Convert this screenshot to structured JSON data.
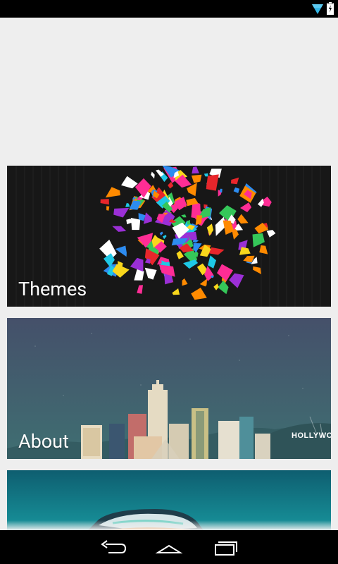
{
  "status_bar": {
    "icons": [
      "wifi-icon",
      "battery-charging-icon"
    ]
  },
  "cards": [
    {
      "label": "Themes"
    },
    {
      "label": "About"
    },
    {
      "label": ""
    }
  ],
  "about_card": {
    "hillside_sign": "HOLLYWOOD"
  },
  "nav_bar": {
    "icons": [
      "back-icon",
      "home-icon",
      "recents-icon"
    ]
  },
  "colors": {
    "background": "#eeeeee",
    "status_bar": "#000000",
    "nav_bar": "#000000",
    "label_text": "#ffffff"
  }
}
